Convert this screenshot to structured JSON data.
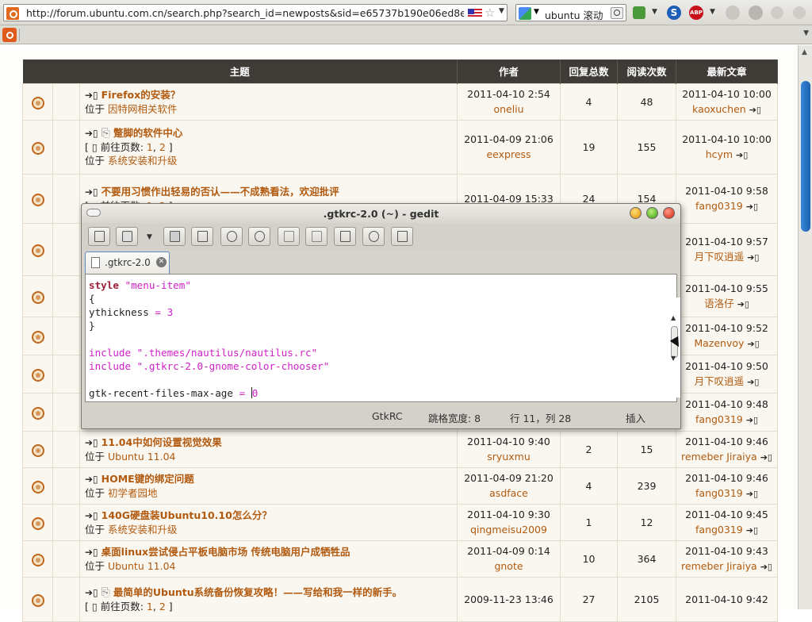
{
  "browser": {
    "url": "http://forum.ubuntu.com.cn/search.php?search_id=newposts&sid=e65737b190e06ed8e65",
    "search_text": "ubuntu 滚动"
  },
  "forum": {
    "headers": [
      "主题",
      "作者",
      "回复总数",
      "阅读次数",
      "最新文章"
    ],
    "location_prefix": "位于",
    "pages_prefix": "前往页数:",
    "rows": [
      {
        "title": "Firefox的安装？",
        "attach": false,
        "pages": null,
        "forum": "因特网相关软件",
        "date": "2011-04-10 2:54",
        "author": "oneliu",
        "replies": "4",
        "views": "48",
        "last_time": "2011-04-10 10:00",
        "last_user": "kaoxuchen"
      },
      {
        "title": "蹩脚的软件中心",
        "attach": true,
        "pages": [
          "1",
          "2"
        ],
        "forum": "系统安装和升级",
        "date": "2011-04-09 21:06",
        "author": "eexpress",
        "replies": "19",
        "views": "155",
        "last_time": "2011-04-10 10:00",
        "last_user": "hcym"
      },
      {
        "title": "不要用习惯作出轻易的否认——不成熟看法，欢迎批评",
        "attach": false,
        "pages": [
          "1",
          "2"
        ],
        "forum": "",
        "date": "2011-04-09 15:33",
        "author": "",
        "replies": "24",
        "views": "154",
        "last_time": "2011-04-10 9:58",
        "last_user": "fang0319"
      },
      {
        "title": "",
        "attach": false,
        "pages": null,
        "forum": "",
        "date": "",
        "author": "",
        "replies": "",
        "views": "",
        "last_time": "2011-04-10 9:57",
        "last_user": "月下叹逍遥"
      },
      {
        "title": "",
        "attach": false,
        "pages": null,
        "forum": "",
        "date": "",
        "author": "",
        "replies": "",
        "views": "",
        "last_time": "2011-04-10 9:55",
        "last_user": "语洛仔"
      },
      {
        "title": "",
        "attach": false,
        "pages": null,
        "forum": "",
        "date": "",
        "author": "",
        "replies": "",
        "views": "",
        "last_time": "2011-04-10 9:52",
        "last_user": "Mazenvoy"
      },
      {
        "title": "",
        "attach": false,
        "pages": null,
        "forum": "",
        "date": "",
        "author": "",
        "replies": "",
        "views": "",
        "last_time": "2011-04-10 9:50",
        "last_user": "月下叹逍遥"
      },
      {
        "title": "",
        "attach": false,
        "pages": null,
        "forum": "",
        "date": "",
        "author": "",
        "replies": "",
        "views": "",
        "last_time": "2011-04-10 9:48",
        "last_user": "fang0319"
      },
      {
        "title": "11.04中如何设置视觉效果",
        "attach": false,
        "pages": null,
        "forum": "Ubuntu 11.04",
        "date": "2011-04-10 9:40",
        "author": "sryuxmu",
        "replies": "2",
        "views": "15",
        "last_time": "2011-04-10 9:46",
        "last_user": "remeber Jiraiya"
      },
      {
        "title": "HOME键的绑定问题",
        "attach": false,
        "pages": null,
        "forum": "初学者园地",
        "date": "2011-04-09 21:20",
        "author": "asdface",
        "replies": "4",
        "views": "239",
        "last_time": "2011-04-10 9:46",
        "last_user": "fang0319"
      },
      {
        "title": "140G硬盘装Ubuntu10.10怎么分？",
        "attach": false,
        "pages": null,
        "forum": "系统安装和升级",
        "date": "2011-04-10 9:30",
        "author": "qingmeisu2009",
        "replies": "1",
        "views": "12",
        "last_time": "2011-04-10 9:45",
        "last_user": "fang0319"
      },
      {
        "title": "桌面linux尝试侵占平板电脑市场 传统电脑用户成牺牲品",
        "attach": false,
        "pages": null,
        "forum": "Ubuntu 11.04",
        "date": "2011-04-09 0:14",
        "author": "gnote",
        "replies": "10",
        "views": "364",
        "last_time": "2011-04-10 9:43",
        "last_user": "remeber Jiraiya"
      },
      {
        "title": "最简单的Ubuntu系统备份恢复攻略！——写给和我一样的新手。",
        "attach": true,
        "pages": [
          "1",
          "2"
        ],
        "forum": "",
        "date": "2009-11-23 13:46",
        "author": "",
        "replies": "27",
        "views": "2105",
        "last_time": "2011-04-10 9:42",
        "last_user": ""
      }
    ]
  },
  "gedit": {
    "window_title": ".gtkrc-2.0 (~) - gedit",
    "tab_label": ".gtkrc-2.0",
    "code": {
      "l1_kw": "style",
      "l1_str": "\"menu-item\"",
      "l2": "{",
      "l3_a": "ythickness",
      "l3_op": "=",
      "l3_num": "3",
      "l4": "}",
      "l6_kw": "include",
      "l6_str": "\".themes/nautilus/nautilus.rc\"",
      "l7_kw": "include",
      "l7_str": "\".gtkrc-2.0-gnome-color-chooser\"",
      "l9_a": "gtk-recent-files-max-age",
      "l9_op": "=",
      "l9_num": "0"
    },
    "status": {
      "language": "GtkRC",
      "tab_width": "跳格宽度: 8",
      "position": "行 11，列 28",
      "mode": "插入"
    }
  },
  "icons": [
    "ubuntu-favicon",
    "us-flag-icon",
    "bookmark-star-icon",
    "google-icon",
    "search-icon",
    "adblock-icon",
    "lightbulb-topic-icon",
    "goto-last-post-icon",
    "attachment-icon",
    "new-file-icon",
    "open-file-icon",
    "save-icon",
    "print-icon",
    "undo-icon",
    "redo-icon",
    "cut-icon",
    "copy-icon",
    "paste-icon",
    "find-icon",
    "find-replace-icon",
    "close-tab-icon"
  ],
  "colors": {
    "header_bg": "#3f3c37",
    "link": "#b15a0f",
    "row_bg": "#faf7f0",
    "keyword": "#a0203a",
    "string": "#d020c8"
  }
}
